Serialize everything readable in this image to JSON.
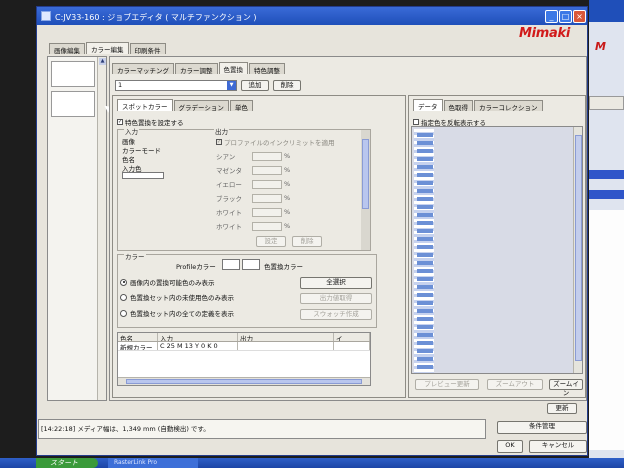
{
  "window": {
    "title": "C:JV33-160 : ジョブエディタ ( マルチファンクション )",
    "logo": "Mimaki"
  },
  "top_tabs": [
    "画像編集",
    "カラー編集",
    "印刷条件"
  ],
  "sub_tabs": [
    "カラーマッチング",
    "カラー調整",
    "色置換",
    "特色調整"
  ],
  "selector": {
    "value": "1",
    "add_label": "追加",
    "delete_label": "削除"
  },
  "left_group": {
    "inner_tabs": [
      "スポットカラー",
      "グラデーション",
      "単色"
    ],
    "enable_checkbox": {
      "label": "特色置換を設定する",
      "checked": true
    },
    "input": {
      "caption": "入力",
      "fields": [
        "画像",
        "カラーモード",
        "色名",
        "入力色"
      ]
    },
    "output": {
      "caption": "出力",
      "profile_checkbox": {
        "label": "プロファイルのインクリミットを適用",
        "checked": true
      },
      "inks": [
        "シアン",
        "マゼンタ",
        "イエロー",
        "ブラック",
        "ホワイト",
        "ホワイト"
      ],
      "unit": "%",
      "set_label": "設定",
      "delete_label": "削除"
    },
    "color_section": {
      "caption": "カラー",
      "profile_label": "Profileカラー",
      "replace_label": "色置換カラー",
      "select_all_label": "全選択",
      "output_cancel_label": "出力値取得",
      "swatch_label": "スウォッチ作成",
      "radios": [
        {
          "label": "画像内の置換可能色のみ表示",
          "selected": true
        },
        {
          "label": "色置換セット内の未使用色のみ表示",
          "selected": false
        },
        {
          "label": "色置換セット内の全ての定義を表示",
          "selected": false
        }
      ]
    },
    "table": {
      "headers": [
        "色名",
        "入力",
        "出力",
        "イ"
      ],
      "rows": [
        [
          "新規カラー",
          "C 25 M 13 Y 0 K 0",
          "",
          ""
        ]
      ]
    }
  },
  "right_group": {
    "tabs": [
      "データ",
      "色取得",
      "カラーコレクション"
    ],
    "reverse_checkbox": {
      "label": "指定色を反転表示する",
      "checked": false
    },
    "preview_update_label": "プレビュー更新",
    "zoom_out_label": "ズームアウト",
    "zoom_in_label": "ズームイン"
  },
  "update_label": "更新",
  "status_message": "[14:22:18] メディア幅は、1,349 mm (自動検出) です。",
  "condition_label": "条件管理",
  "ok_label": "OK",
  "cancel_label": "キャンセル",
  "taskbar": {
    "start_label": "スタート",
    "task_label": "RasterLink Pro"
  },
  "colors": {
    "title_bar": "#1f4fb9",
    "logo_red": "#d11a1a",
    "panel_bg": "#eceae3",
    "scroll_blue": "#b9c6ee"
  }
}
